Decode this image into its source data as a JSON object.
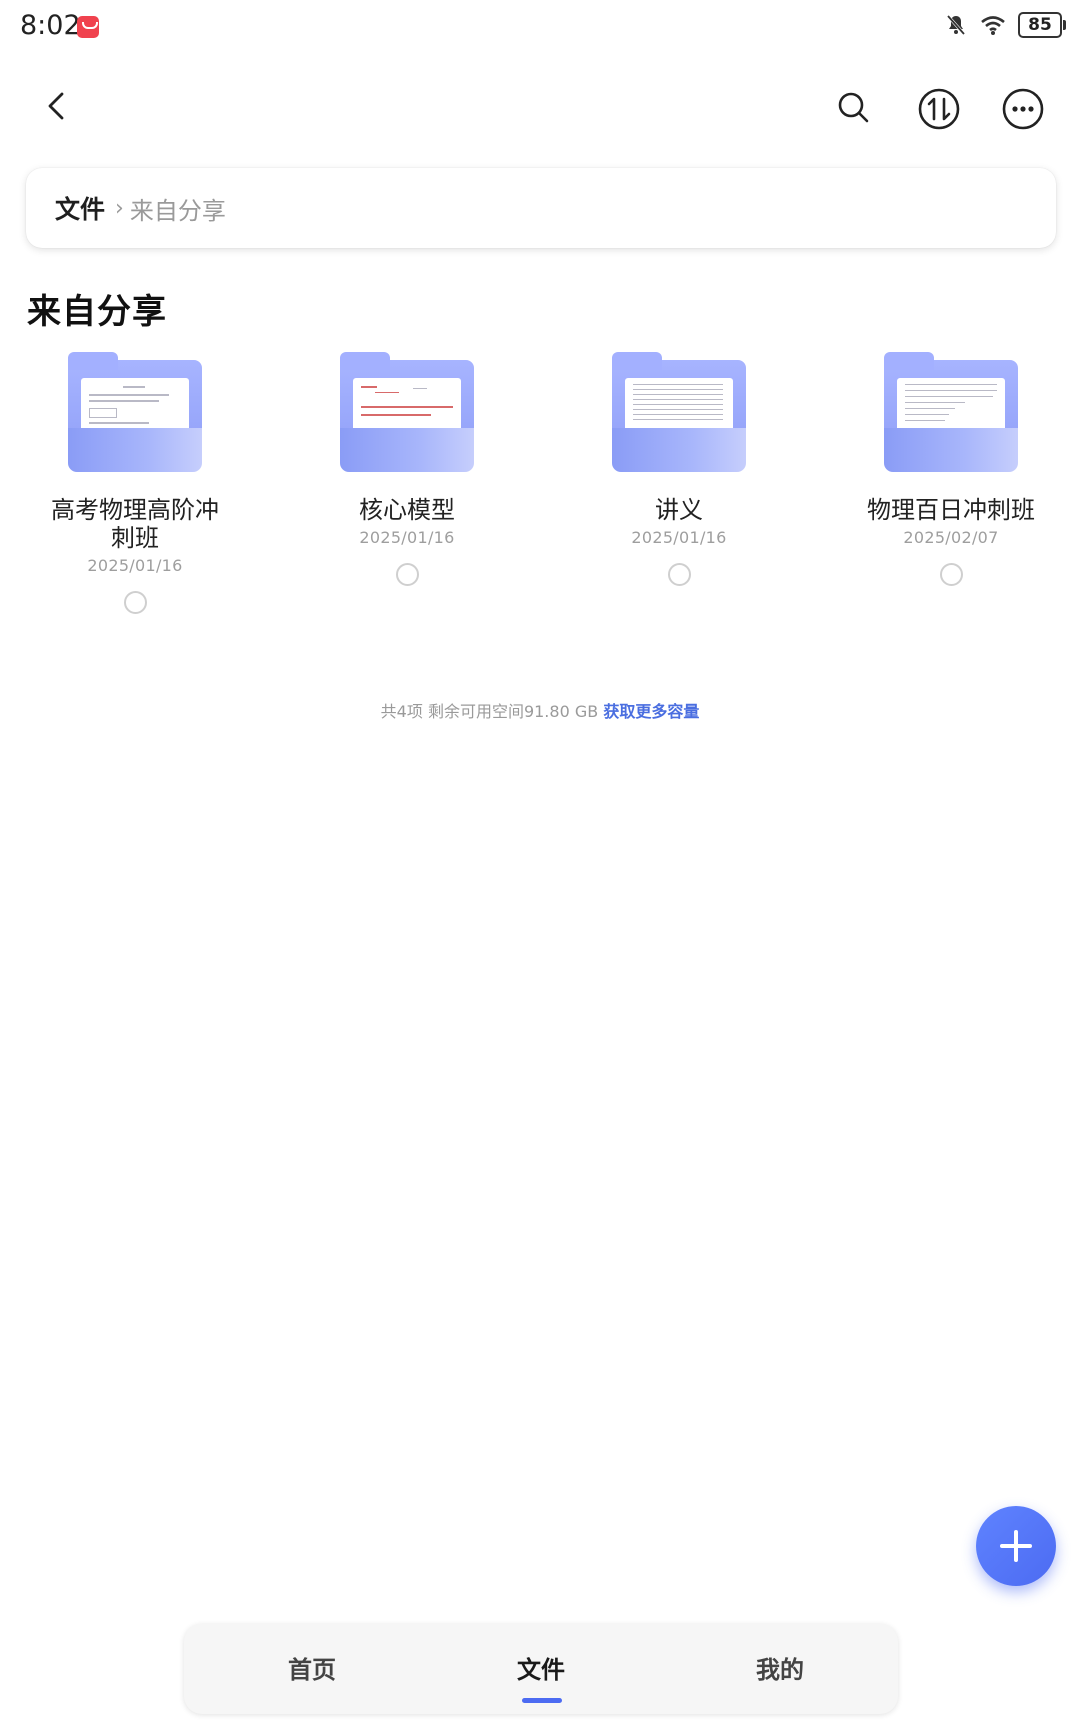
{
  "status_bar": {
    "time": "8:02",
    "battery": "85",
    "icons": [
      "app-notification-icon",
      "bell-muted-icon",
      "wifi-icon",
      "battery-icon"
    ]
  },
  "toolbar": {
    "back_icon": "chevron-left-icon",
    "search_icon": "search-icon",
    "sort_icon": "sort-arrows-icon",
    "more_icon": "more-dots-icon"
  },
  "breadcrumb": {
    "root": "文件",
    "separator": "›",
    "current": "来自分享"
  },
  "section": {
    "title": "来自分享"
  },
  "folders": [
    {
      "name": "高考物理高阶冲刺班",
      "date": "2025/01/16"
    },
    {
      "name": "核心模型",
      "date": "2025/01/16"
    },
    {
      "name": "讲义",
      "date": "2025/01/16"
    },
    {
      "name": "物理百日冲刺班",
      "date": "2025/02/07"
    }
  ],
  "storage": {
    "summary": "共4项 剩余可用空间91.80 GB",
    "link": "获取更多容量"
  },
  "fab": {
    "icon": "plus-icon"
  },
  "tabs": [
    {
      "label": "首页"
    },
    {
      "label": "文件"
    },
    {
      "label": "我的"
    }
  ],
  "colors": {
    "accent": "#4c6bf2",
    "folder": "#9aa8fb",
    "link": "#4a6ee0"
  }
}
